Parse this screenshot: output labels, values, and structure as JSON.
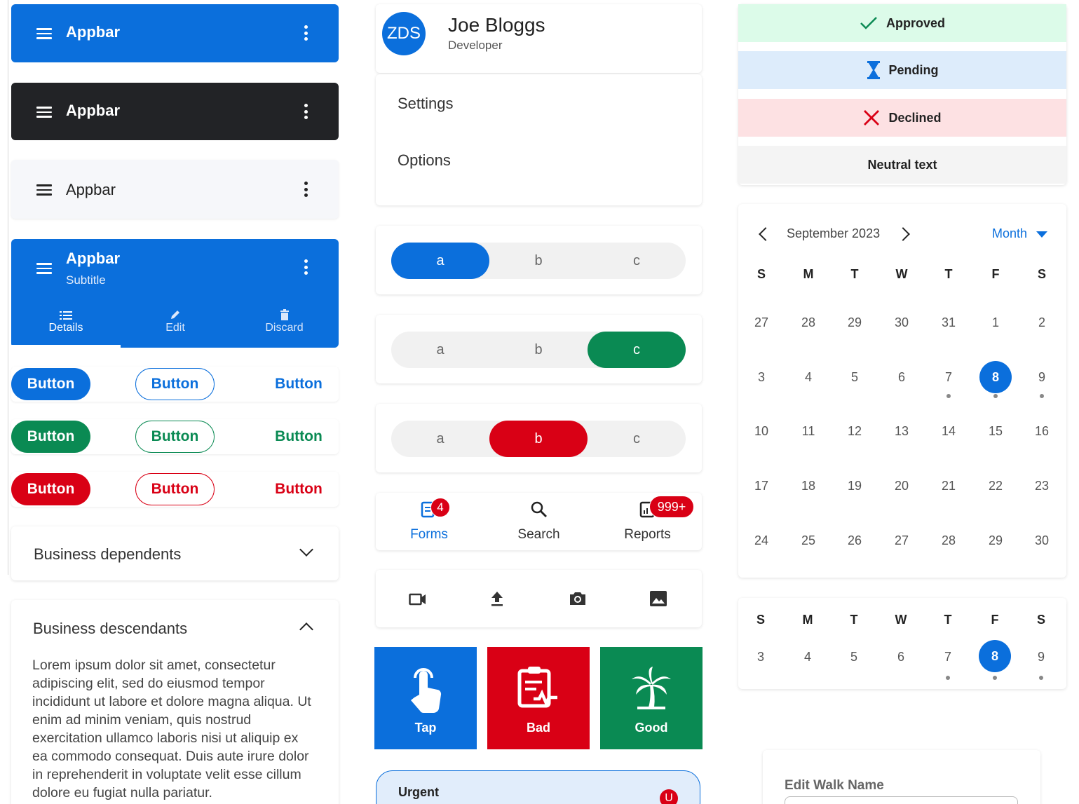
{
  "appbars": [
    {
      "title": "Appbar",
      "bg": "#0b6fdc",
      "fg": "#ffffff"
    },
    {
      "title": "Appbar",
      "bg": "#222326",
      "fg": "#ffffff"
    },
    {
      "title": "Appbar",
      "bg": "#f6f7fa",
      "fg": "#222222"
    },
    {
      "title": "Appbar",
      "subtitle": "Subtitle",
      "bg": "#0b6fdc",
      "fg": "#ffffff"
    }
  ],
  "tabs": [
    {
      "label": "Details",
      "icon": "list-icon"
    },
    {
      "label": "Edit",
      "icon": "pencil-icon"
    },
    {
      "label": "Discard",
      "icon": "trash-icon"
    }
  ],
  "buttons": {
    "label": "Button",
    "colors": [
      "#0b6fdc",
      "#0a8a53",
      "#d90015"
    ]
  },
  "expanders": [
    {
      "title": "Business dependents",
      "expanded": false
    },
    {
      "title": "Business descendants",
      "expanded": true,
      "body": "Lorem ipsum dolor sit amet, consectetur adipiscing elit, sed do eiusmod tempor incididunt ut labore et dolore magna aliqua. Ut enim ad minim veniam, quis nostrud exercitation ullamco laboris nisi ut aliquip ex ea commodo consequat. Duis aute irure dolor in reprehenderit in voluptate velit esse cillum dolore eu fugiat nulla pariatur."
    }
  ],
  "profile": {
    "initials": "ZDS",
    "name": "Joe Bloggs",
    "role": "Developer"
  },
  "menu": [
    "Settings",
    "Options"
  ],
  "segmented": [
    {
      "options": [
        "a",
        "b",
        "c"
      ],
      "selected": 0,
      "color": "#0b6fdc"
    },
    {
      "options": [
        "a",
        "b",
        "c"
      ],
      "selected": 2,
      "color": "#0a8a53"
    },
    {
      "options": [
        "a",
        "b",
        "c"
      ],
      "selected": 1,
      "color": "#d90015"
    }
  ],
  "bottom_nav": [
    {
      "label": "Forms",
      "icon": "forms-icon",
      "badge": "4",
      "active": true
    },
    {
      "label": "Search",
      "icon": "search-icon",
      "badge": "",
      "active": false
    },
    {
      "label": "Reports",
      "icon": "reports-icon",
      "badge": "999+",
      "active": false
    }
  ],
  "toolbar_icons": [
    "video-icon",
    "upload-icon",
    "camera-icon",
    "image-icon"
  ],
  "tiles": [
    {
      "label": "Tap",
      "icon": "tap-icon",
      "bg": "#0b6fdc"
    },
    {
      "label": "Bad",
      "icon": "clipboard-pulse-icon",
      "bg": "#d90015"
    },
    {
      "label": "Good",
      "icon": "palm-tree-icon",
      "bg": "#0a8a53"
    }
  ],
  "urgent": {
    "label": "Urgent",
    "badge": "U"
  },
  "statuses": [
    {
      "label": "Approved",
      "icon": "check-icon",
      "bg": "#dcfbe9"
    },
    {
      "label": "Pending",
      "icon": "hourglass-icon",
      "bg": "#ddecfb"
    },
    {
      "label": "Declined",
      "icon": "cross-icon",
      "bg": "#fde1e3"
    },
    {
      "label": "Neutral text",
      "icon": "",
      "bg": "#f4f4f4"
    }
  ],
  "calendar": {
    "month": "September 2023",
    "view": "Month",
    "weekdays": [
      "S",
      "M",
      "T",
      "W",
      "T",
      "F",
      "S"
    ],
    "weeks": [
      [
        "27",
        "28",
        "29",
        "30",
        "31",
        "1",
        "2"
      ],
      [
        "3",
        "4",
        "5",
        "6",
        "7",
        "8",
        "9"
      ],
      [
        "10",
        "11",
        "12",
        "13",
        "14",
        "15",
        "16"
      ],
      [
        "17",
        "18",
        "19",
        "20",
        "21",
        "22",
        "23"
      ],
      [
        "24",
        "25",
        "26",
        "27",
        "28",
        "29",
        "30"
      ]
    ],
    "selected": "8",
    "week_strip": [
      "3",
      "4",
      "5",
      "6",
      "7",
      "8",
      "9"
    ]
  },
  "edit_walk": {
    "label": "Edit Walk Name"
  }
}
